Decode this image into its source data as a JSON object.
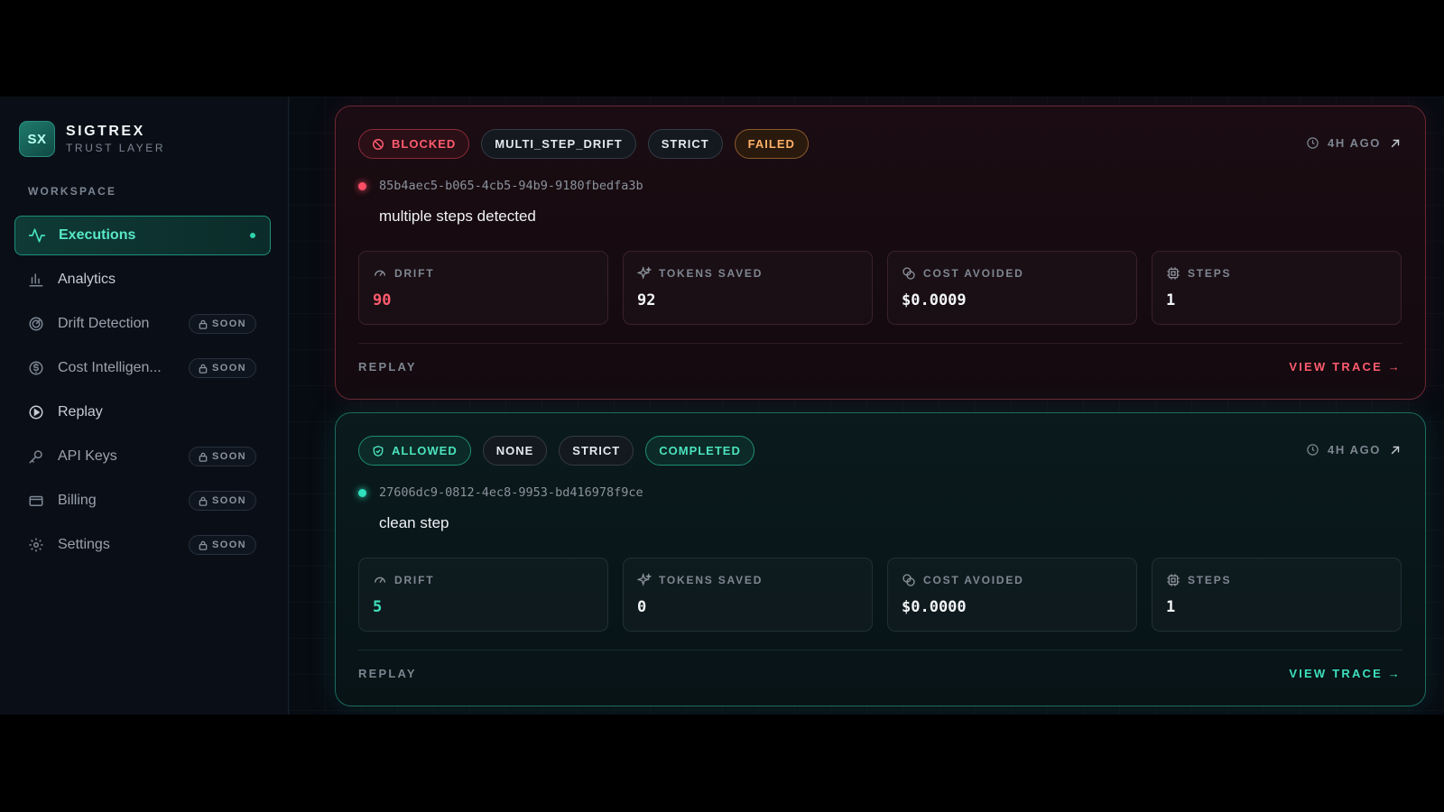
{
  "brand": {
    "logo": "SX",
    "name": "SIGTREX",
    "subtitle": "TRUST LAYER"
  },
  "sidebar": {
    "section_label": "WORKSPACE",
    "items": [
      {
        "label": "Executions",
        "icon": "activity-icon",
        "active": true
      },
      {
        "label": "Analytics",
        "icon": "bar-chart-icon"
      },
      {
        "label": "Drift Detection",
        "icon": "radar-icon",
        "badge": "SOON"
      },
      {
        "label": "Cost Intelligen...",
        "icon": "dollar-circle-icon",
        "badge": "SOON"
      },
      {
        "label": "Replay",
        "icon": "play-circle-icon"
      },
      {
        "label": "API Keys",
        "icon": "key-icon",
        "badge": "SOON"
      },
      {
        "label": "Billing",
        "icon": "credit-card-icon",
        "badge": "SOON"
      },
      {
        "label": "Settings",
        "icon": "gear-icon",
        "badge": "SOON"
      }
    ]
  },
  "executions": [
    {
      "status": "BLOCKED",
      "reason": "MULTI_STEP_DRIFT",
      "mode": "STRICT",
      "result": "FAILED",
      "time_ago": "4H AGO",
      "id": "85b4aec5-b065-4cb5-94b9-9180fbedfa3b",
      "description": "multiple steps detected",
      "stats": {
        "drift_label": "DRIFT",
        "drift": "90",
        "tokens_label": "TOKENS SAVED",
        "tokens": "92",
        "cost_label": "COST AVOIDED",
        "cost": "$0.0009",
        "steps_label": "STEPS",
        "steps": "1"
      },
      "replay_label": "REPLAY",
      "view_trace_label": "VIEW TRACE →",
      "accent": "#ff5b6e"
    },
    {
      "status": "ALLOWED",
      "reason": "NONE",
      "mode": "STRICT",
      "result": "COMPLETED",
      "time_ago": "4H AGO",
      "id": "27606dc9-0812-4ec8-9953-bd416978f9ce",
      "description": "clean step",
      "stats": {
        "drift_label": "DRIFT",
        "drift": "5",
        "tokens_label": "TOKENS SAVED",
        "tokens": "0",
        "cost_label": "COST AVOIDED",
        "cost": "$0.0000",
        "steps_label": "STEPS",
        "steps": "1"
      },
      "replay_label": "REPLAY",
      "view_trace_label": "VIEW TRACE →",
      "accent": "#3ee0bd"
    }
  ]
}
